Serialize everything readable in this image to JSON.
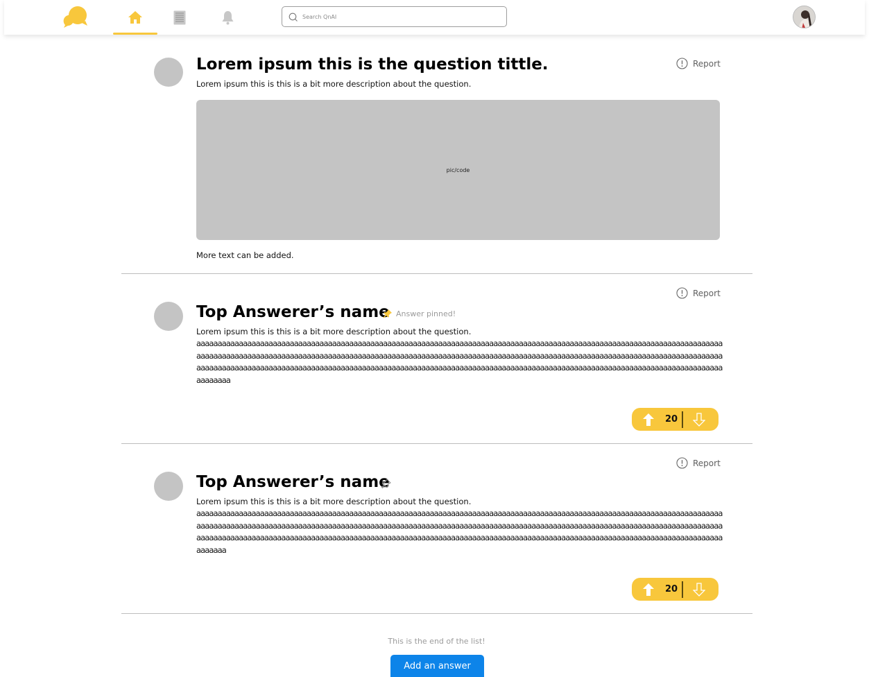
{
  "nav": {
    "search_placeholder": "Search QnAI",
    "accent_color": "#f8c73c",
    "icons": [
      "logo-chat-bubbles",
      "home-icon",
      "list-icon",
      "bell-icon",
      "search-icon"
    ]
  },
  "question": {
    "title": "Lorem ipsum this is the question tittle.",
    "description": "Lorem ipsum this is this is a bit more description about the question.",
    "media_label": "pic/code",
    "extra_text": "More text can be added.",
    "report_label": "Report"
  },
  "answers": [
    {
      "name": "Top Answerer’s name",
      "pin_label": "Answer pinned!",
      "pinned": true,
      "description": "Lorem ipsum this is this is a bit more description about the question.",
      "body": "aaaaaaaaaaaaaaaaaaaaaaaaaaaaaaaaaaaaaaaaaaaaaaaaaaaaaaaaaaaaaaaaaaaaaaaaaaaaaaaaaaaaaaaaaaaaaaaaaaaaaaaaaaaaaaaaaaaaaaaaaaaaaaaaaaaaaaaaaaaaaaaaaaaaaaaaaaaaaaaaaaaaaaaaaaaaaaaaaaaaaaaaaaaaaaaaaaaaaaaaaaaaaaaaaaaaaaaaaaaaaaaaaaaaaaaaaaaaaaaaaaaaaaaaaaaaaaaaaaaaaaaaaaaaaaaaaaaaaaaaaaaaaaaaaaaaaaaaaaaaaaaaaaaaaaaaaaaaaaaaaaaaaaaaaaaaaaaaaaaaaaaaaaaaaaaaaaaaaaaaaaaaaaaaaaaaaaaaaaaa",
      "votes": "20",
      "report_label": "Report"
    },
    {
      "name": "Top Answerer’s name",
      "pin_label": "",
      "pinned": false,
      "description": "Lorem ipsum this is this is a bit more description about the question.",
      "body": "aaaaaaaaaaaaaaaaaaaaaaaaaaaaaaaaaaaaaaaaaaaaaaaaaaaaaaaaaaaaaaaaaaaaaaaaaaaaaaaaaaaaaaaaaaaaaaaaaaaaaaaaaaaaaaaaaaaaaaaaaaaaaaaaaaaaaaaaaaaaaaaaaaaaaaaaaaaaaaaaaaaaaaaaaaaaaaaaaaaaaaaaaaaaaaaaaaaaaaaaaaaaaaaaaaaaaaaaaaaaaaaaaaaaaaaaaaaaaaaaaaaaaaaaaaaaaaaaaaaaaaaaaaaaaaaaaaaaaaaaaaaaaaaaaaaaaaaaaaaaaaaaaaaaaaaaaaaaaaaaaaaaaaaaaaaaaaaaaaaaaaaaaaaaaaaaaaaaaaaaaaaaaaaaaaaaaaaaaaa",
      "votes": "20",
      "report_label": "Report"
    }
  ],
  "footer": {
    "end_text": "This is the end of the list!",
    "add_answer_label": "Add an answer",
    "button_color": "#0d84e9"
  }
}
